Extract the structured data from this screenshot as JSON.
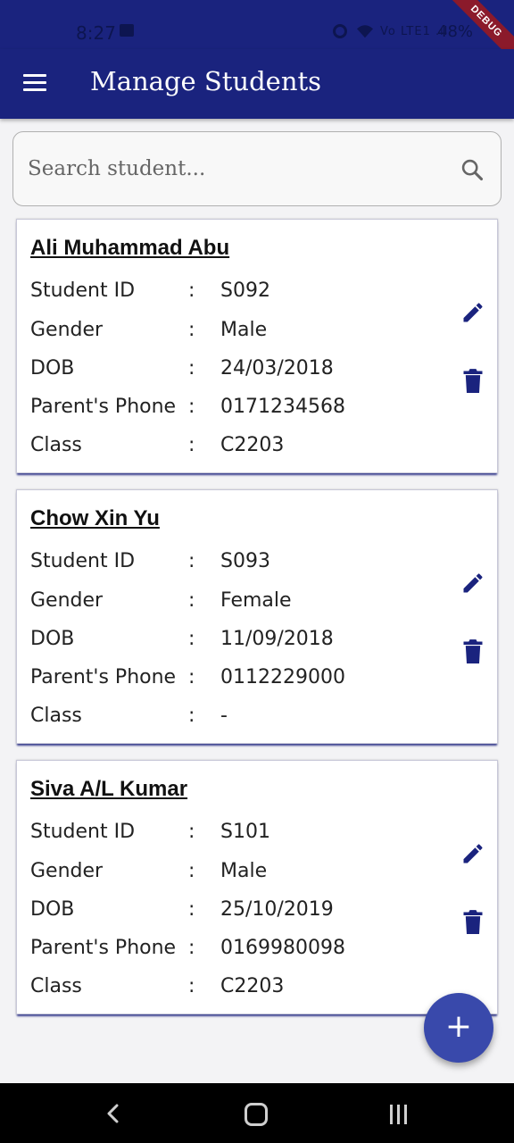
{
  "status_bar": {
    "time": "8:27",
    "signal_text": "Vo LTE1 .ıl",
    "battery": "48%",
    "debug_label": "DEBUG"
  },
  "app_bar": {
    "title": "Manage Students"
  },
  "search": {
    "placeholder": "Search student..."
  },
  "students": [
    {
      "name": "Ali Muhammad Abu",
      "fields": [
        {
          "label": "Student ID",
          "value": "S092"
        },
        {
          "label": "Gender",
          "value": "Male"
        },
        {
          "label": "DOB",
          "value": "24/03/2018"
        },
        {
          "label": "Parent's Phone",
          "value": "0171234568"
        },
        {
          "label": "Class",
          "value": "C2203"
        }
      ]
    },
    {
      "name": "Chow Xin Yu",
      "fields": [
        {
          "label": "Student ID",
          "value": "S093"
        },
        {
          "label": "Gender",
          "value": "Female"
        },
        {
          "label": "DOB",
          "value": "11/09/2018"
        },
        {
          "label": "Parent's Phone",
          "value": "0112229000"
        },
        {
          "label": "Class",
          "value": "-"
        }
      ]
    },
    {
      "name": "Siva A/L Kumar",
      "fields": [
        {
          "label": "Student ID",
          "value": "S101"
        },
        {
          "label": "Gender",
          "value": "Male"
        },
        {
          "label": "DOB",
          "value": "25/10/2019"
        },
        {
          "label": "Parent's Phone",
          "value": "0169980098"
        },
        {
          "label": "Class",
          "value": "C2203"
        }
      ]
    }
  ],
  "separator": ":",
  "fab": {
    "symbol": "+",
    "icon": "add-icon"
  },
  "colors": {
    "primary": "#1a237e",
    "accent": "#3949ab",
    "icon": "#1a237e"
  }
}
